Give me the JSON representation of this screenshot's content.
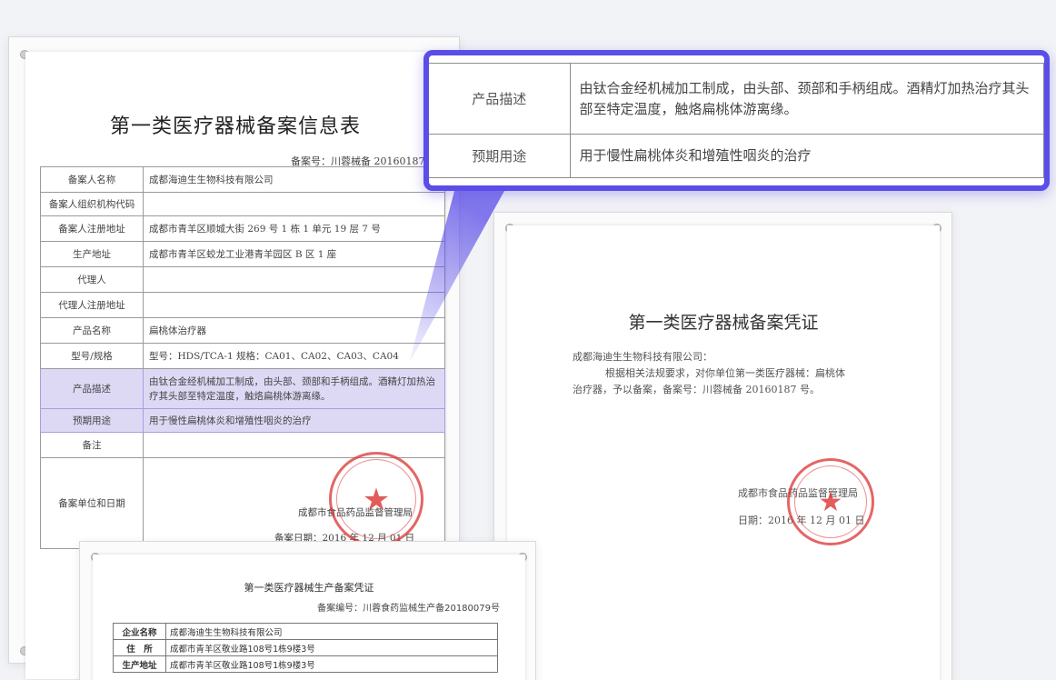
{
  "doc1": {
    "title": "第一类医疗器械备案信息表",
    "record_no": "备案号：川蓉械备 20160187 号",
    "rows": [
      {
        "key": "备案人名称",
        "value": "成都海迪生生物科技有限公司"
      },
      {
        "key": "备案人组织机构代码",
        "value": ""
      },
      {
        "key": "备案人注册地址",
        "value": "成都市青羊区顺城大街 269 号 1 栋 1 单元 19 层 7 号"
      },
      {
        "key": "生产地址",
        "value": "成都市青羊区蛟龙工业港青羊园区 B 区 1 座"
      },
      {
        "key": "代理人",
        "value": ""
      },
      {
        "key": "代理人注册地址",
        "value": ""
      },
      {
        "key": "产品名称",
        "value": "扁桃体治疗器"
      },
      {
        "key": "型号/规格",
        "value": "型号：HDS/TCA-1 规格：CA01、CA02、CA03、CA04"
      },
      {
        "key": "产品描述",
        "value": "由钛合金经机械加工制成，由头部、颈部和手柄组成。酒精灯加热治疗其头部至特定温度，触烙扁桃体游离缘。"
      },
      {
        "key": "预期用途",
        "value": "用于慢性扁桃体炎和增殖性咽炎的治疗"
      },
      {
        "key": "备注",
        "value": ""
      },
      {
        "key": "备案单位和日期",
        "value": ""
      }
    ],
    "unit": "成都市食品药品监督管理局",
    "date": "备案日期：2016 年 12 月 01 日"
  },
  "doc2": {
    "title": "第一类医疗器械备案凭证",
    "addressee": "成都海迪生生物科技有限公司：",
    "body_line1": "根据相关法规要求，对你单位第一类医疗器械：扁桃体",
    "body_line2": "治疗器，予以备案，备案号：川蓉械备 20160187 号。",
    "issuer": "成都市食品药品监督管理局",
    "date": "日期：2016 年 12 月 01 日"
  },
  "doc3": {
    "title": "第一类医疗器械生产备案凭证",
    "record_no": "备案编号：川蓉食药监械生产备20180079号",
    "rows": [
      {
        "key": "企业名称",
        "value": "成都海迪生生物科技有限公司"
      },
      {
        "key": "住　所",
        "value": "成都市青羊区敬业路108号1栋9楼3号"
      },
      {
        "key": "生产地址",
        "value": "成都市青羊区敬业路108号1栋9楼3号"
      }
    ]
  },
  "zoom": {
    "rows": [
      {
        "key": "产品描述",
        "value": "由钛合金经机械加工制成，由头部、颈部和手柄组成。酒精灯加热治疗其头部至特定温度，触烙扁桃体游离缘。"
      },
      {
        "key": "预期用途",
        "value": "用于慢性扁桃体炎和增殖性咽炎的治疗"
      }
    ]
  },
  "colors": {
    "accent": "#5b4de8",
    "highlight": "#ddd9f5",
    "stamp": "#dc3232"
  }
}
